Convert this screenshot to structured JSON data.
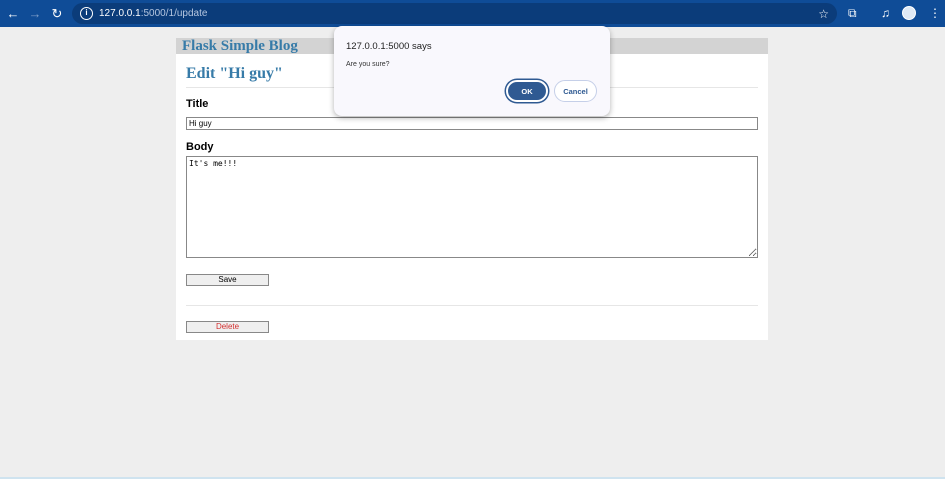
{
  "browser": {
    "url_host": "127.0.0.1",
    "url_rest": ":5000/1/update"
  },
  "page": {
    "brand": "Flask Simple Blog",
    "heading": "Edit \"Hi guy\"",
    "title_label": "Title",
    "title_value": "Hi guy",
    "body_label": "Body",
    "body_value": "It's me!!!",
    "save_label": "Save",
    "delete_label": "Delete"
  },
  "dialog": {
    "title": "127.0.0.1:5000 says",
    "message": "Are you sure?",
    "ok": "OK",
    "cancel": "Cancel"
  }
}
